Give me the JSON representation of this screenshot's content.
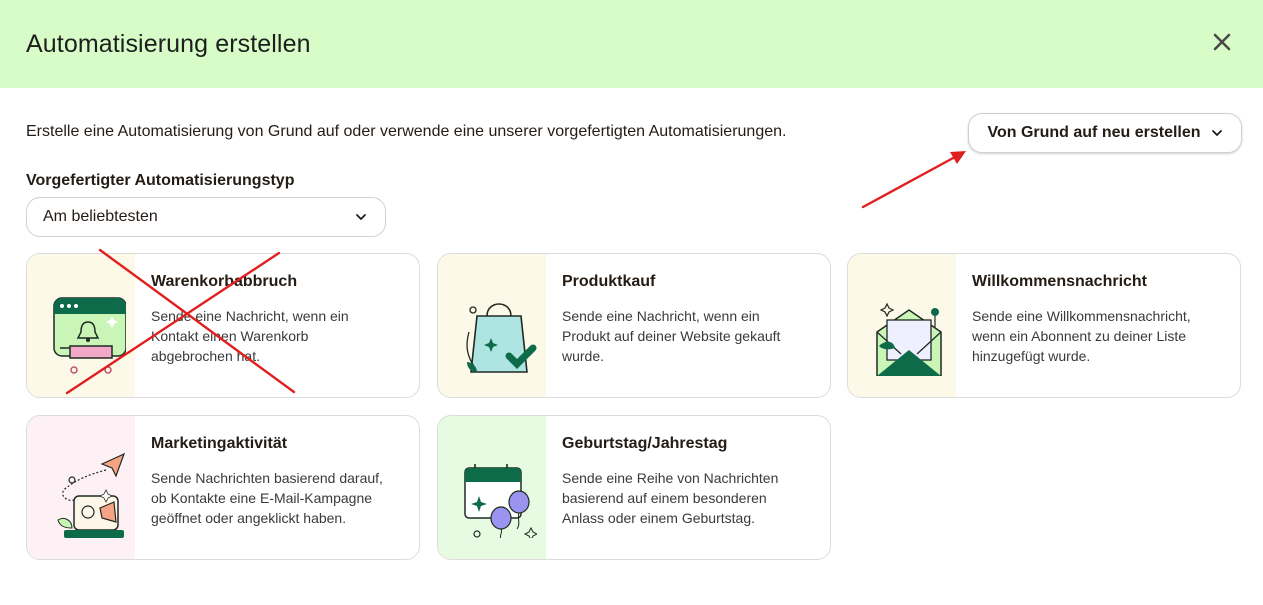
{
  "header": {
    "title": "Automatisierung erstellen",
    "close_icon": "close-icon",
    "background": "#d7fcc8"
  },
  "intro_text": "Erstelle eine Automatisierung von Grund auf oder verwende eine unserer vorgefertigten Automatisierungen.",
  "primary_dropdown": {
    "label": "Von Grund auf neu erstellen",
    "icon": "chevron-down-icon"
  },
  "type_filter": {
    "label": "Vorgefertigter Automatisierungstyp",
    "selected": "Am beliebtesten",
    "icon": "chevron-down-icon"
  },
  "cards": [
    {
      "title": "Warenkorbabbruch",
      "desc": [
        "Sende eine Nachricht, wenn ein",
        "Kontakt einen Warenkorb",
        "abgebrochen hat."
      ],
      "icon": "abandoned-cart-illustration"
    },
    {
      "title": "Produktkauf",
      "desc": [
        "Sende eine Nachricht, wenn ein",
        "Produkt auf deiner Website gekauft",
        "wurde."
      ],
      "icon": "shopping-bag-check-illustration"
    },
    {
      "title": "Willkommensnachricht",
      "desc": [
        "Sende eine Willkommensnachricht,",
        "wenn ein Abonnent zu deiner Liste",
        "hinzugefügt wurde."
      ],
      "icon": "envelope-letter-illustration"
    },
    {
      "title": "Marketingaktivität",
      "desc": [
        "Sende Nachrichten basierend darauf,",
        "ob Kontakte eine E-Mail-Kampagne",
        "geöffnet oder angeklickt haben."
      ],
      "icon": "paper-plane-laptop-illustration"
    },
    {
      "title": "Geburtstag/Jahrestag",
      "desc": [
        "Sende eine Reihe von Nachrichten",
        "basierend auf einem besonderen",
        "Anlass oder einem Geburtstag."
      ],
      "icon": "calendar-balloons-illustration"
    }
  ],
  "annotations": {
    "color": "#e02020",
    "cross_mark": "red-x-mark",
    "arrow": "red-arrow"
  }
}
